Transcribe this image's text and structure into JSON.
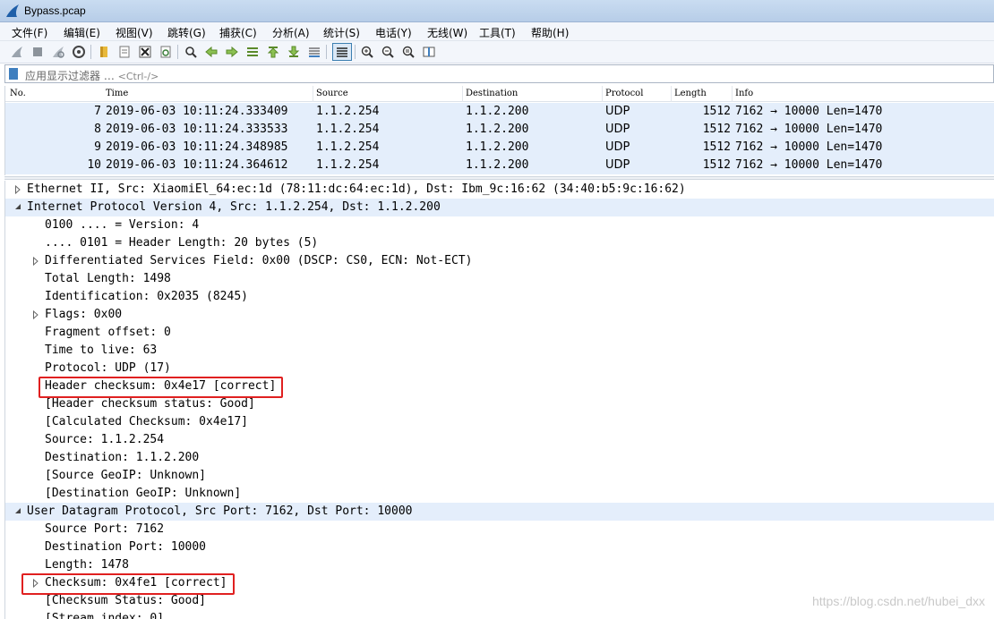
{
  "window": {
    "title": "Bypass.pcap"
  },
  "menu": [
    "文件(F)",
    "编辑(E)",
    "视图(V)",
    "跳转(G)",
    "捕获(C)",
    "分析(A)",
    "统计(S)",
    "电话(Y)",
    "无线(W)",
    "工具(T)",
    "帮助(H)"
  ],
  "toolbar": {
    "icons": [
      "shark-fin-start-icon",
      "stop-icon",
      "restart-icon",
      "capture-options-icon",
      "open-file-icon",
      "save-file-icon",
      "close-file-icon",
      "reload-icon",
      "find-icon",
      "go-back-icon",
      "go-forward-icon",
      "go-to-packet-icon",
      "first-packet-icon",
      "last-packet-icon",
      "autoscroll-icon",
      "colorize-icon",
      "zoom-in-icon",
      "zoom-out-icon",
      "normal-size-icon",
      "resize-columns-icon"
    ]
  },
  "filter": {
    "placeholder": "应用显示过滤器 … ",
    "shortcut": "<Ctrl-/>"
  },
  "packet_list": {
    "columns": [
      "No.",
      "Time",
      "Source",
      "Destination",
      "Protocol",
      "Length",
      "Info"
    ],
    "rows": [
      {
        "no": "7",
        "time": "2019-06-03 10:11:24.333409",
        "source": "1.1.2.254",
        "destination": "1.1.2.200",
        "protocol": "UDP",
        "length": "1512",
        "info": "7162 → 10000 Len=1470"
      },
      {
        "no": "8",
        "time": "2019-06-03 10:11:24.333533",
        "source": "1.1.2.254",
        "destination": "1.1.2.200",
        "protocol": "UDP",
        "length": "1512",
        "info": "7162 → 10000 Len=1470"
      },
      {
        "no": "9",
        "time": "2019-06-03 10:11:24.348985",
        "source": "1.1.2.254",
        "destination": "1.1.2.200",
        "protocol": "UDP",
        "length": "1512",
        "info": "7162 → 10000 Len=1470"
      },
      {
        "no": "10",
        "time": "2019-06-03 10:11:24.364612",
        "source": "1.1.2.254",
        "destination": "1.1.2.200",
        "protocol": "UDP",
        "length": "1512",
        "info": "7162 → 10000 Len=1470"
      }
    ]
  },
  "details": [
    {
      "text": "Ethernet II, Src: XiaomiEl_64:ec:1d (78:11:dc:64:ec:1d), Dst: Ibm_9c:16:62 (34:40:b5:9c:16:62)",
      "level": 0,
      "arrow": "collapsed"
    },
    {
      "text": "Internet Protocol Version 4, Src: 1.1.2.254, Dst: 1.1.2.200",
      "level": 0,
      "arrow": "expanded",
      "selected": true
    },
    {
      "text": "0100 .... = Version: 4",
      "level": 1,
      "arrow": "none"
    },
    {
      "text": ".... 0101 = Header Length: 20 bytes (5)",
      "level": 1,
      "arrow": "none"
    },
    {
      "text": "Differentiated Services Field: 0x00 (DSCP: CS0, ECN: Not-ECT)",
      "level": 1,
      "arrow": "collapsed"
    },
    {
      "text": "Total Length: 1498",
      "level": 1,
      "arrow": "none"
    },
    {
      "text": "Identification: 0x2035 (8245)",
      "level": 1,
      "arrow": "none"
    },
    {
      "text": "Flags: 0x00",
      "level": 1,
      "arrow": "collapsed"
    },
    {
      "text": "Fragment offset: 0",
      "level": 1,
      "arrow": "none"
    },
    {
      "text": "Time to live: 63",
      "level": 1,
      "arrow": "none"
    },
    {
      "text": "Protocol: UDP (17)",
      "level": 1,
      "arrow": "none"
    },
    {
      "text": "Header checksum: 0x4e17 [correct]",
      "level": 1,
      "arrow": "none",
      "highlight": true
    },
    {
      "text": "[Header checksum status: Good]",
      "level": 1,
      "arrow": "none"
    },
    {
      "text": "[Calculated Checksum: 0x4e17]",
      "level": 1,
      "arrow": "none"
    },
    {
      "text": "Source: 1.1.2.254",
      "level": 1,
      "arrow": "none"
    },
    {
      "text": "Destination: 1.1.2.200",
      "level": 1,
      "arrow": "none"
    },
    {
      "text": "[Source GeoIP: Unknown]",
      "level": 1,
      "arrow": "none"
    },
    {
      "text": "[Destination GeoIP: Unknown]",
      "level": 1,
      "arrow": "none"
    },
    {
      "text": "User Datagram Protocol, Src Port: 7162, Dst Port: 10000",
      "level": 0,
      "arrow": "expanded",
      "selected": true
    },
    {
      "text": "Source Port: 7162",
      "level": 1,
      "arrow": "none"
    },
    {
      "text": "Destination Port: 10000",
      "level": 1,
      "arrow": "none"
    },
    {
      "text": "Length: 1478",
      "level": 1,
      "arrow": "none"
    },
    {
      "text": "Checksum: 0x4fe1 [correct]",
      "level": 1,
      "arrow": "collapsed",
      "highlight": true
    },
    {
      "text": "[Checksum Status: Good]",
      "level": 1,
      "arrow": "none"
    },
    {
      "text": "[Stream index: 0]",
      "level": 1,
      "arrow": "none"
    }
  ],
  "watermark": "https://blog.csdn.net/hubei_dxx",
  "colors": {
    "selected_row": "#e4eefb",
    "highlight_box": "#e02020",
    "accent": "#3f7fbf"
  }
}
